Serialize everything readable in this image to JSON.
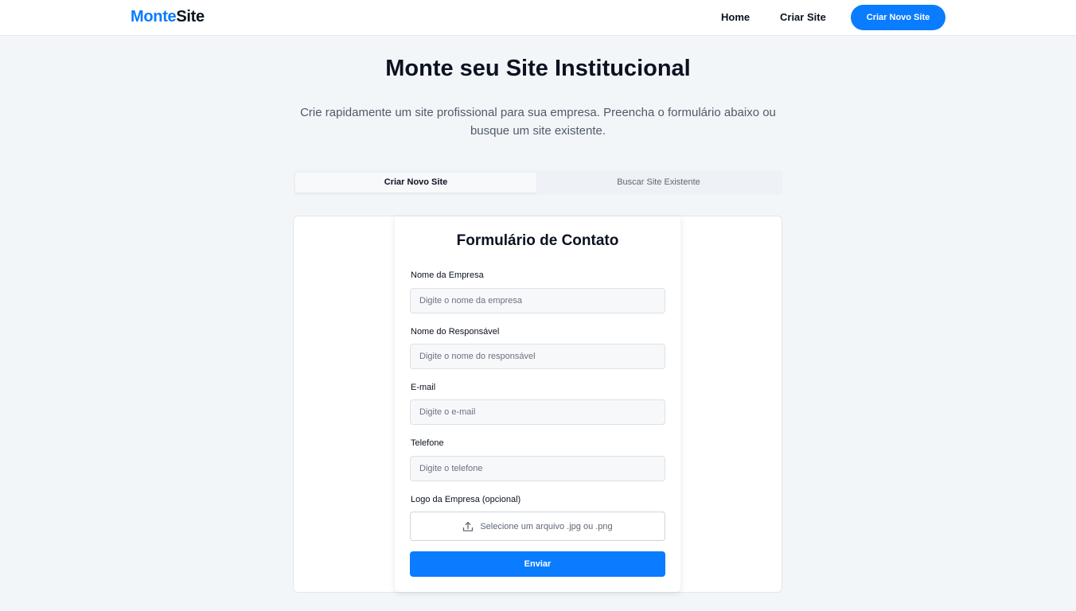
{
  "nav": {
    "logo_part1": "Monte",
    "logo_part2": "Site",
    "home": "Home",
    "criar_site": "Criar Site",
    "cta": "Criar Novo Site"
  },
  "hero": {
    "title": "Monte seu Site Institucional",
    "subtitle": "Crie rapidamente um site profissional para sua empresa. Preencha o formulário abaixo ou busque um site existente."
  },
  "tabs": [
    {
      "label": "Criar Novo Site",
      "active": true
    },
    {
      "label": "Buscar Site Existente",
      "active": false
    }
  ],
  "form": {
    "title": "Formulário de Contato",
    "fields": [
      {
        "label": "Nome da Empresa",
        "placeholder": "Digite o nome da empresa",
        "value": ""
      },
      {
        "label": "Nome do Responsável",
        "placeholder": "Digite o nome do responsável",
        "value": ""
      },
      {
        "label": "E-mail",
        "placeholder": "Digite o e-mail",
        "value": ""
      },
      {
        "label": "Telefone",
        "placeholder": "Digite o telefone",
        "value": ""
      }
    ],
    "logo_label": "Logo da Empresa (opcional)",
    "upload_text": "Selecione um arquivo .jpg ou .png",
    "upload_icon": "upload-icon",
    "submit": "Enviar"
  },
  "colors": {
    "accent": "#0a7cff",
    "background": "#f3f6f9",
    "text": "#0b1220"
  }
}
